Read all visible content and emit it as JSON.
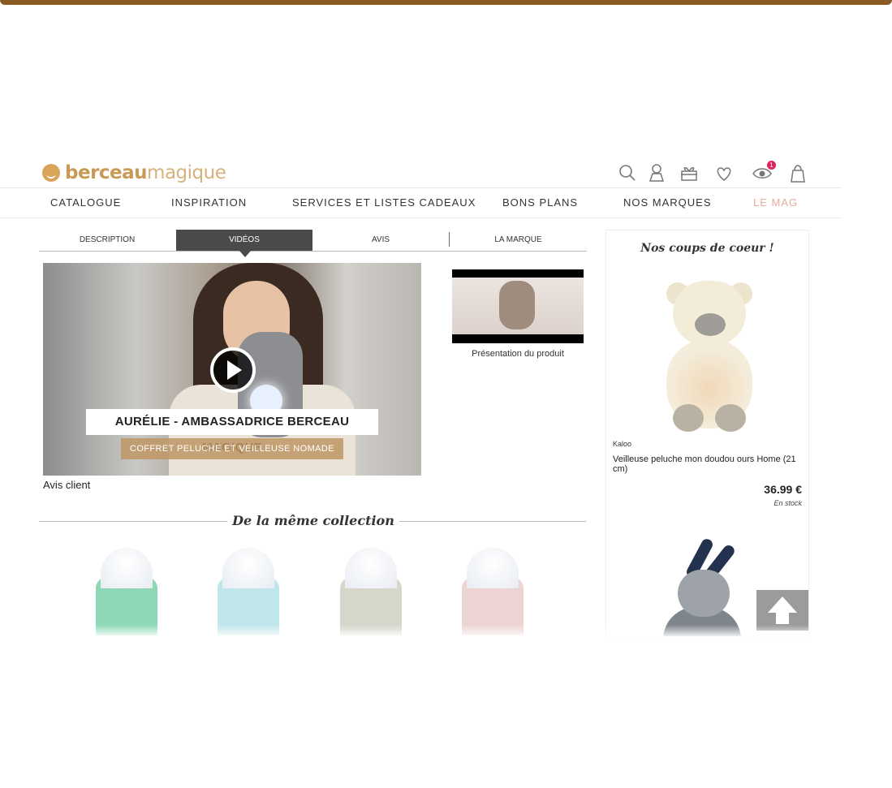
{
  "logo": {
    "part1": "berceau",
    "part2": "magique"
  },
  "header_icons": [
    "search-icon",
    "user-icon",
    "gift-icon",
    "heart-icon",
    "eye-icon",
    "bag-icon"
  ],
  "eye_badge": "1",
  "nav": [
    "CATALOGUE",
    "INSPIRATION",
    "SERVICES ET LISTES CADEAUX",
    "BONS PLANS",
    "NOS MARQUES",
    "LE MAG"
  ],
  "tabs": [
    "DESCRIPTION",
    "VIDÉOS",
    "AVIS",
    "LA MARQUE"
  ],
  "video": {
    "caption_title": "AURÉLIE - AMBASSADRICE BERCEAU MAGIQUE",
    "caption_sub": "COFFRET PELUCHE ET VEILLEUSE NOMADE",
    "label": "Avis client"
  },
  "thumbnail": {
    "caption": "Présentation du produit"
  },
  "collection": {
    "title": "De la même collection"
  },
  "sidebar": {
    "title": "Nos coups de coeur !",
    "product": {
      "brand": "Kaloo",
      "name": "Veilleuse peluche mon doudou ours Home (21 cm)",
      "price": "36.99 €",
      "stock": "En stock"
    }
  },
  "colors": {
    "brand": "#c99a55",
    "active_tab": "#4a4a4a",
    "le_mag": "#e6a9a0",
    "badge": "#e0245e"
  }
}
